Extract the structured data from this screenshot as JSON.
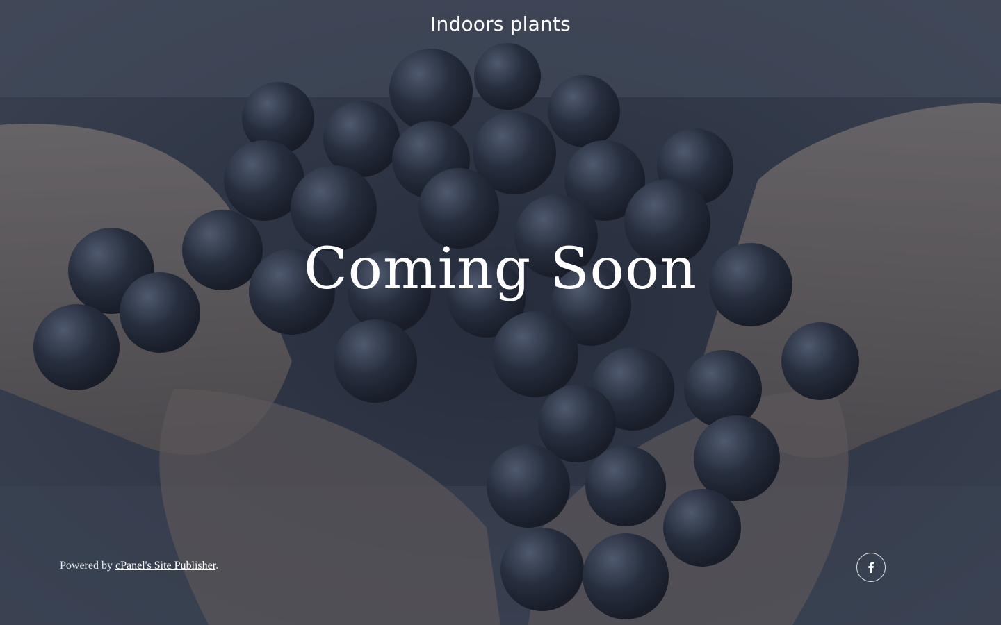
{
  "site": {
    "title": "Indoors plants"
  },
  "hero": {
    "headline": "Coming Soon"
  },
  "footer": {
    "powered_prefix": "Powered by ",
    "powered_link": "cPanel's Site Publisher",
    "powered_suffix": "."
  },
  "social": {
    "facebook_icon": "facebook-icon"
  },
  "colors": {
    "text": "#ffffff",
    "overlay": "#1e2432"
  }
}
